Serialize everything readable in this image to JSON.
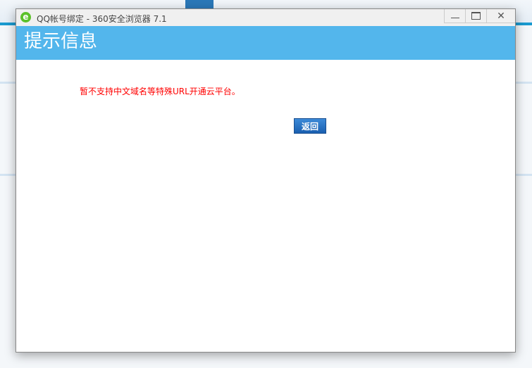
{
  "window": {
    "title": "QQ帐号绑定 - 360安全浏览器 7.1",
    "icon": "ie-e-icon",
    "controls": [
      "minimize",
      "maximize",
      "close"
    ]
  },
  "header": {
    "title": "提示信息"
  },
  "main": {
    "message": "暂不支持中文域名等特殊URL开通云平台。",
    "back_label": "返回"
  },
  "colors": {
    "header": "#53b6ec",
    "message": "#ff0000",
    "button": "#2a6fc0"
  }
}
